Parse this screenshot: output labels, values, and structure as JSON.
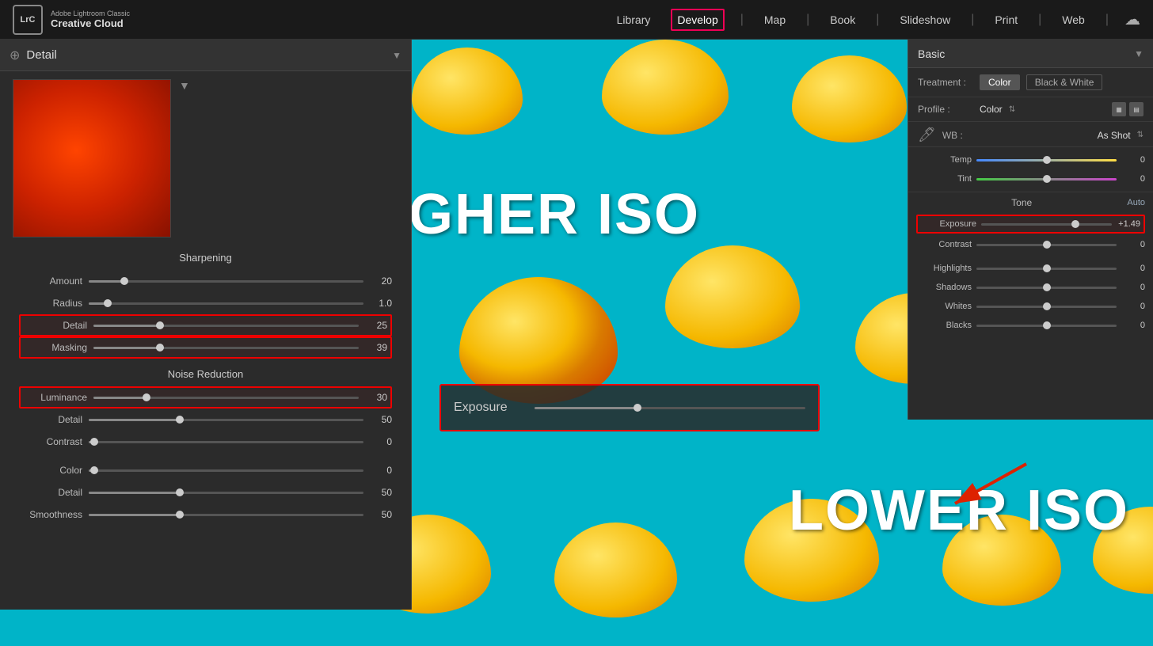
{
  "navbar": {
    "logo_text": "LrC",
    "app_line1": "Adobe Lightroom Classic",
    "app_line2": "Creative Cloud",
    "nav_items": [
      "Library",
      "Develop",
      "Map",
      "Book",
      "Slideshow",
      "Print",
      "Web"
    ],
    "active_nav": "Develop"
  },
  "overlay": {
    "higher_iso": "HIGHER ISO",
    "lower_iso": "LOWER ISO"
  },
  "left_panel": {
    "title": "Detail",
    "thumbnail_section": "",
    "sharpening_label": "Sharpening",
    "amount_label": "Amount",
    "amount_value": "20",
    "amount_percent": 13,
    "radius_label": "Radius",
    "radius_value": "1.0",
    "radius_percent": 7,
    "detail_label": "Detail",
    "detail_value": "25",
    "detail_percent": 16,
    "masking_label": "Masking",
    "masking_value": "39",
    "masking_percent": 25,
    "noise_reduction_label": "Noise Reduction",
    "luminance_label": "Luminance",
    "luminance_value": "30",
    "luminance_percent": 20,
    "lum_detail_label": "Detail",
    "lum_detail_value": "50",
    "lum_detail_percent": 33,
    "lum_contrast_label": "Contrast",
    "lum_contrast_value": "0",
    "lum_contrast_percent": 0,
    "color_label": "Color",
    "color_value": "0",
    "color_percent": 0,
    "color_detail_label": "Detail",
    "color_detail_value": "50",
    "color_detail_percent": 33,
    "smoothness_label": "Smoothness",
    "smoothness_value": "50",
    "smoothness_percent": 33
  },
  "right_panel": {
    "title": "Basic",
    "treatment_label": "Treatment :",
    "color_btn": "Color",
    "bw_btn": "Black & White",
    "profile_label": "Profile :",
    "profile_value": "Color",
    "wb_label": "WB :",
    "wb_value": "As Shot",
    "temp_label": "Temp",
    "temp_value": "0",
    "temp_percent": 50,
    "tint_label": "Tint",
    "tint_value": "0",
    "tint_percent": 50,
    "tone_label": "Tone",
    "tone_auto": "Auto",
    "exposure_label": "Exposure",
    "exposure_value": "+1.49",
    "exposure_percent": 72,
    "contrast_label": "Contrast",
    "contrast_value": "0",
    "contrast_percent": 50,
    "highlights_label": "Highlights",
    "highlights_value": "0",
    "highlights_percent": 50,
    "shadows_label": "Shadows",
    "shadows_value": "0",
    "shadows_percent": 50,
    "whites_label": "Whites",
    "whites_value": "0",
    "whites_percent": 50,
    "blacks_label": "Blacks",
    "blacks_value": "0",
    "blacks_percent": 50
  },
  "center_exposure": {
    "label": "Exposure",
    "percent": 38
  }
}
